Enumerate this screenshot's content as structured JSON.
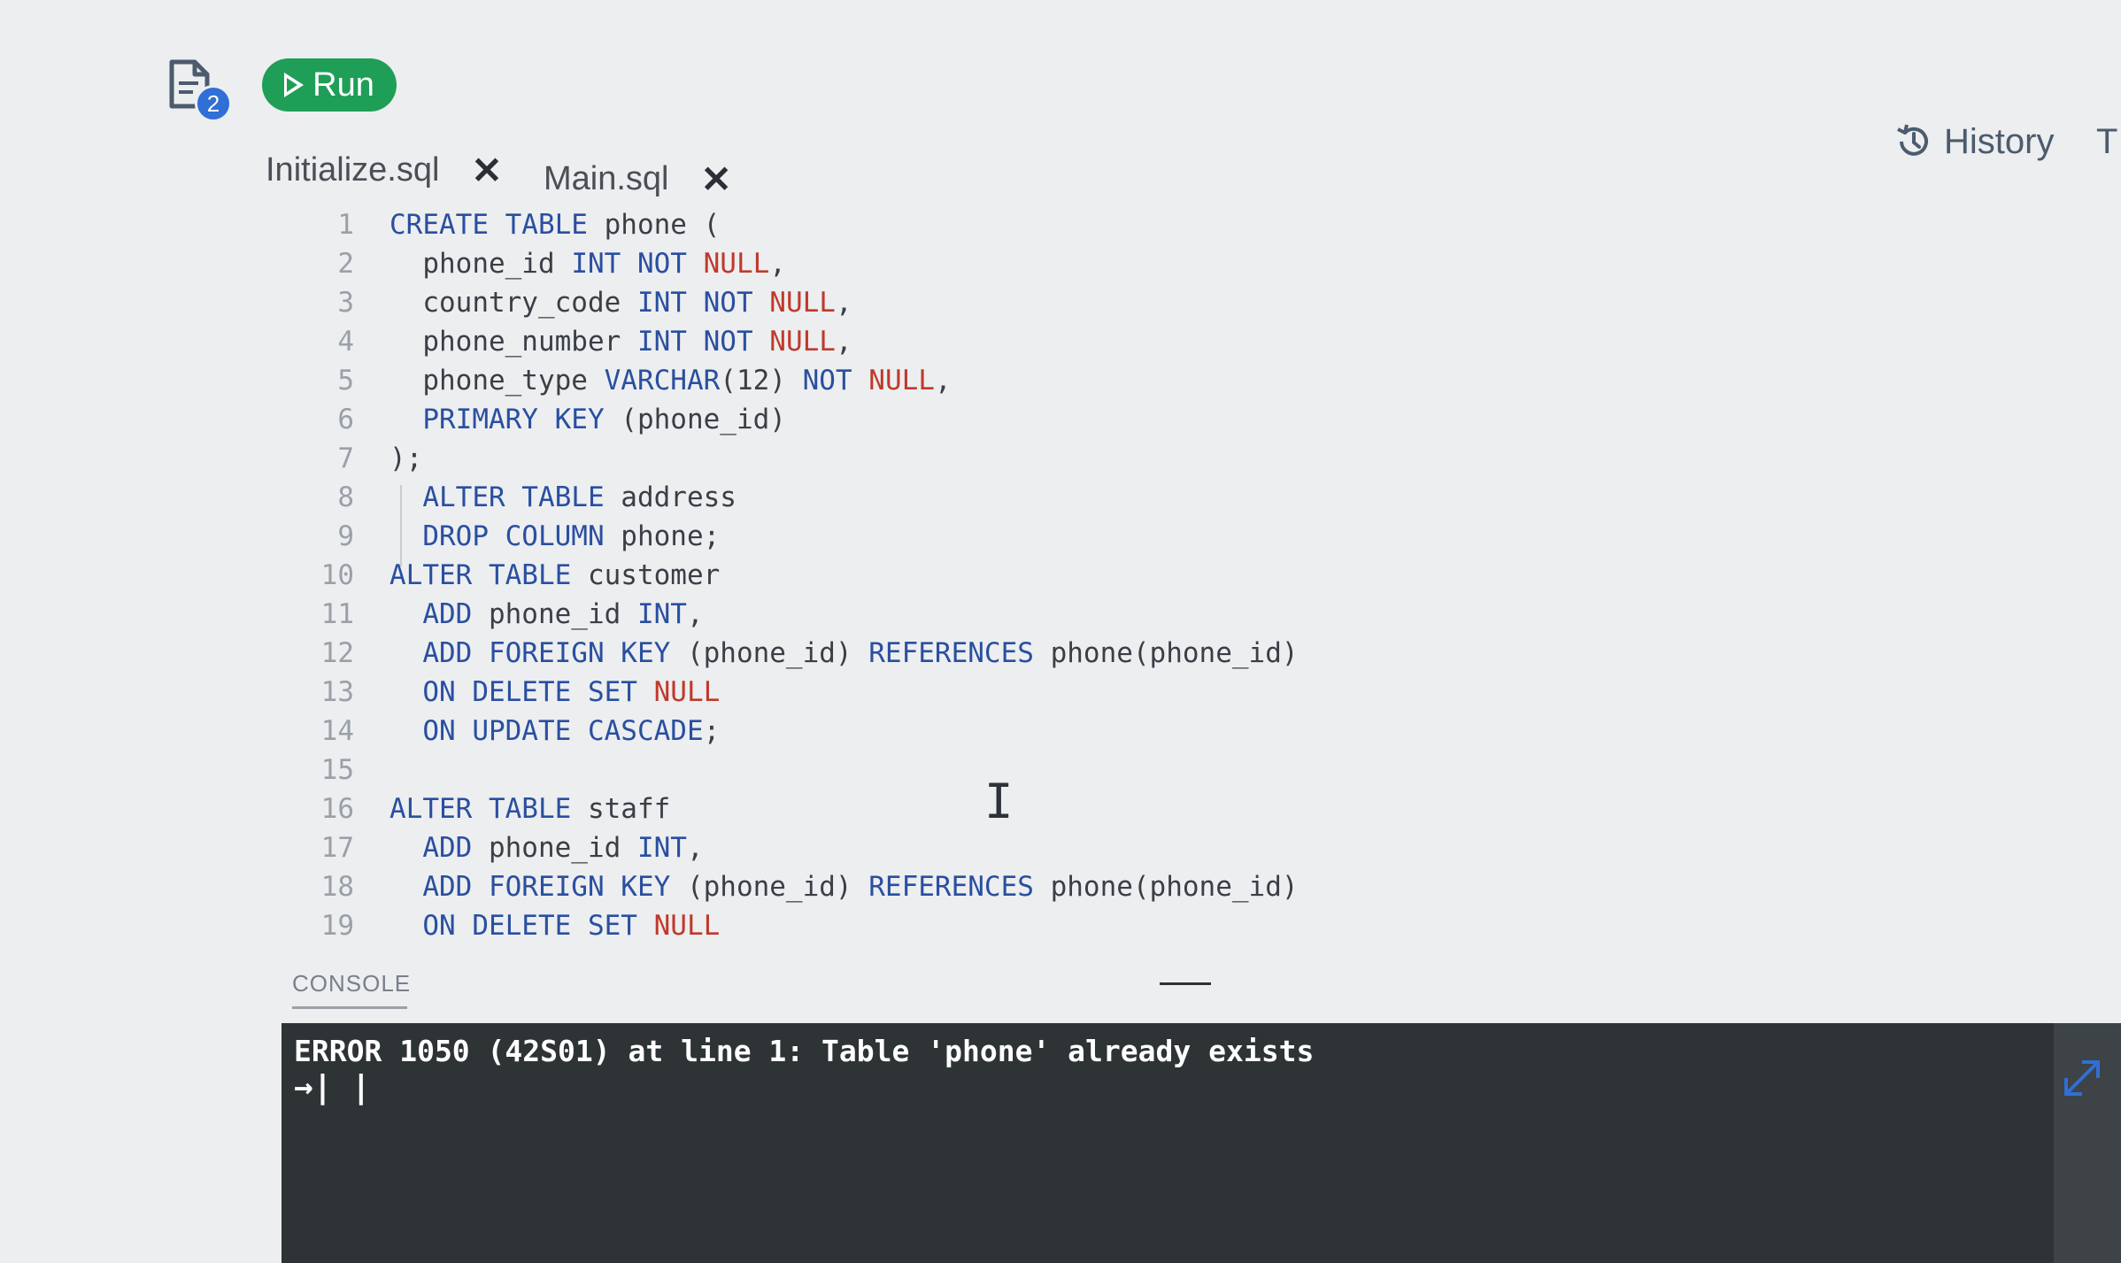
{
  "toolbar": {
    "files_badge": "2",
    "run_label": "Run",
    "history_label": "History",
    "clipped_next_label": "T"
  },
  "tabs": [
    {
      "label": "Initialize.sql"
    },
    {
      "label": "Main.sql"
    }
  ],
  "tab_close_glyph": "✕",
  "editor": {
    "lines": [
      {
        "n": "1",
        "tokens": [
          {
            "t": "CREATE TABLE ",
            "k": "kw"
          },
          {
            "t": "phone (",
            "k": "pn"
          }
        ]
      },
      {
        "n": "2",
        "tokens": [
          {
            "t": "  phone_id ",
            "k": "pn"
          },
          {
            "t": "INT NOT ",
            "k": "kw"
          },
          {
            "t": "NULL",
            "k": "nl"
          },
          {
            "t": ",",
            "k": "pn"
          }
        ]
      },
      {
        "n": "3",
        "tokens": [
          {
            "t": "  country_code ",
            "k": "pn"
          },
          {
            "t": "INT NOT ",
            "k": "kw"
          },
          {
            "t": "NULL",
            "k": "nl"
          },
          {
            "t": ",",
            "k": "pn"
          }
        ]
      },
      {
        "n": "4",
        "tokens": [
          {
            "t": "  phone_number ",
            "k": "pn"
          },
          {
            "t": "INT NOT ",
            "k": "kw"
          },
          {
            "t": "NULL",
            "k": "nl"
          },
          {
            "t": ",",
            "k": "pn"
          }
        ]
      },
      {
        "n": "5",
        "tokens": [
          {
            "t": "  phone_type ",
            "k": "pn"
          },
          {
            "t": "VARCHAR",
            "k": "kw"
          },
          {
            "t": "(12) ",
            "k": "pn"
          },
          {
            "t": "NOT ",
            "k": "kw"
          },
          {
            "t": "NULL",
            "k": "nl"
          },
          {
            "t": ",",
            "k": "pn"
          }
        ]
      },
      {
        "n": "6",
        "tokens": [
          {
            "t": "  PRIMARY KEY ",
            "k": "kw"
          },
          {
            "t": "(phone_id)",
            "k": "pn"
          }
        ]
      },
      {
        "n": "7",
        "tokens": [
          {
            "t": ");",
            "k": "pn"
          }
        ]
      },
      {
        "n": "8",
        "tokens": [
          {
            "t": "  ALTER TABLE ",
            "k": "kw"
          },
          {
            "t": "address",
            "k": "pn"
          }
        ]
      },
      {
        "n": "9",
        "tokens": [
          {
            "t": "  DROP COLUMN ",
            "k": "kw"
          },
          {
            "t": "phone;",
            "k": "pn"
          }
        ]
      },
      {
        "n": "10",
        "tokens": [
          {
            "t": "ALTER TABLE ",
            "k": "kw"
          },
          {
            "t": "customer",
            "k": "pn"
          }
        ]
      },
      {
        "n": "11",
        "tokens": [
          {
            "t": "  ADD ",
            "k": "kw"
          },
          {
            "t": "phone_id ",
            "k": "pn"
          },
          {
            "t": "INT",
            "k": "kw"
          },
          {
            "t": ",",
            "k": "pn"
          }
        ]
      },
      {
        "n": "12",
        "tokens": [
          {
            "t": "  ADD FOREIGN KEY ",
            "k": "kw"
          },
          {
            "t": "(phone_id) ",
            "k": "pn"
          },
          {
            "t": "REFERENCES ",
            "k": "kw"
          },
          {
            "t": "phone(phone_id)",
            "k": "pn"
          }
        ]
      },
      {
        "n": "13",
        "tokens": [
          {
            "t": "  ON DELETE SET ",
            "k": "kw"
          },
          {
            "t": "NULL",
            "k": "nl"
          }
        ]
      },
      {
        "n": "14",
        "tokens": [
          {
            "t": "  ON UPDATE CASCADE",
            "k": "kw"
          },
          {
            "t": ";",
            "k": "pn"
          }
        ]
      },
      {
        "n": "15",
        "tokens": []
      },
      {
        "n": "16",
        "tokens": [
          {
            "t": "ALTER TABLE ",
            "k": "kw"
          },
          {
            "t": "staff",
            "k": "pn"
          }
        ]
      },
      {
        "n": "17",
        "tokens": [
          {
            "t": "  ADD ",
            "k": "kw"
          },
          {
            "t": "phone_id ",
            "k": "pn"
          },
          {
            "t": "INT",
            "k": "kw"
          },
          {
            "t": ",",
            "k": "pn"
          }
        ]
      },
      {
        "n": "18",
        "tokens": [
          {
            "t": "  ADD FOREIGN KEY ",
            "k": "kw"
          },
          {
            "t": "(phone_id) ",
            "k": "pn"
          },
          {
            "t": "REFERENCES ",
            "k": "kw"
          },
          {
            "t": "phone(phone_id)",
            "k": "pn"
          }
        ]
      },
      {
        "n": "19",
        "tokens": [
          {
            "t": "  ON DELETE SET ",
            "k": "kw"
          },
          {
            "t": "NULL",
            "k": "nl"
          }
        ]
      }
    ],
    "text_cursor_glyph": "I"
  },
  "console": {
    "label": "CONSOLE",
    "error": "ERROR 1050 (42S01) at line 1: Table 'phone' already exists",
    "prompt": "→| |"
  },
  "colors": {
    "run_button": "#1f9e57",
    "badge": "#2f6fd6",
    "keyword": "#2a4fa0",
    "null_keyword": "#c0392b",
    "console_bg": "#2e3336"
  },
  "icons": {
    "files": "files-icon",
    "run": "play-icon",
    "history": "history-clock-icon",
    "tab_close": "close-icon",
    "expand": "expand-icon"
  }
}
